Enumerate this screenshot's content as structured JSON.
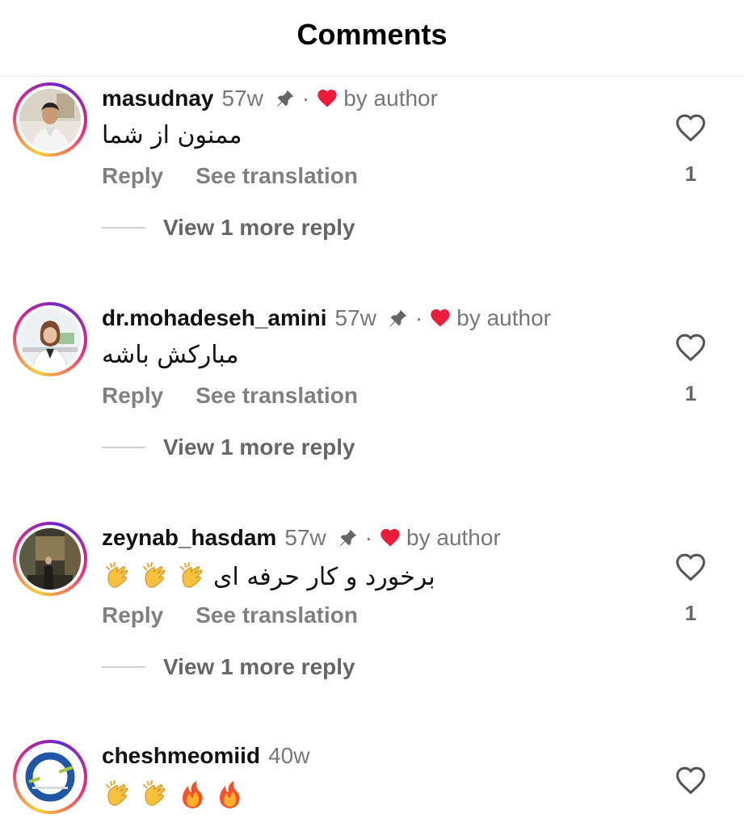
{
  "header": {
    "title": "Comments"
  },
  "comments": [
    {
      "username": "masudnay",
      "time": "57w",
      "by_author": "by author",
      "text": "ممنون از شما",
      "reply": "Reply",
      "see_translation": "See translation",
      "view_more": "View 1 more reply",
      "likes": "1"
    },
    {
      "username": "dr.mohadeseh_amini",
      "time": "57w",
      "by_author": "by author",
      "text": "مبارکش باشه",
      "reply": "Reply",
      "see_translation": "See translation",
      "view_more": "View 1 more reply",
      "likes": "1"
    },
    {
      "username": "zeynab_hasdam",
      "time": "57w",
      "by_author": "by author",
      "text": "برخورد و کار حرفه ای",
      "reply": "Reply",
      "see_translation": "See translation",
      "view_more": "View 1 more reply",
      "likes": "1"
    },
    {
      "username": "cheshmeomiid",
      "time": "40w"
    }
  ],
  "colors": {
    "accent_heart": "#ed1c3a",
    "muted_text": "#777777",
    "ring_gradient": [
      "#f9ce34",
      "#ee2a7b",
      "#6228d7"
    ]
  },
  "icons": {
    "pin": "pin-icon",
    "liked_by_author": "red-heart-icon",
    "like": "heart-outline-icon",
    "clap": "clapping-hands-emoji",
    "fire": "fire-emoji"
  }
}
